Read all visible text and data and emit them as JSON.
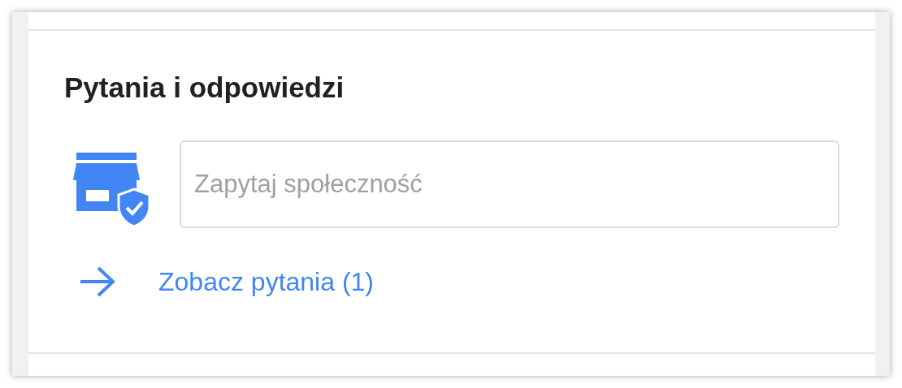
{
  "section": {
    "title": "Pytania i odpowiedzi",
    "ask_field": {
      "placeholder": "Zapytaj społeczność"
    },
    "link": {
      "label": "Zobacz pytania (1)"
    }
  }
}
